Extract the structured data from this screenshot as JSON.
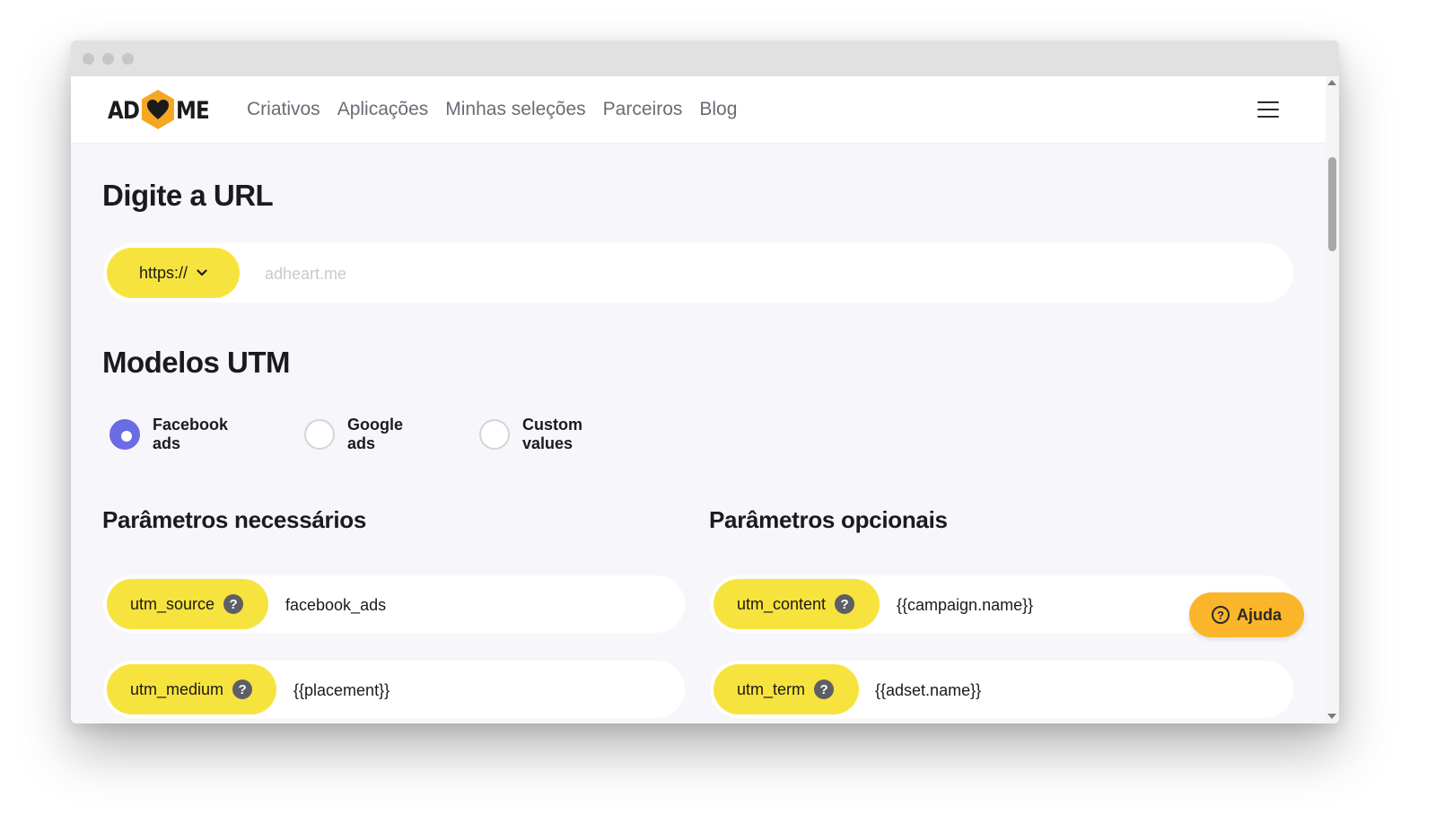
{
  "nav": {
    "logo_left": "AD",
    "logo_right": "ME",
    "links": [
      "Criativos",
      "Aplicações",
      "Minhas seleções",
      "Parceiros",
      "Blog"
    ]
  },
  "url_section": {
    "title": "Digite a URL",
    "protocol": "https://",
    "placeholder": "adheart.me",
    "value": ""
  },
  "utm_section": {
    "title": "Modelos UTM",
    "options": [
      {
        "label": "Facebook ads",
        "checked": true
      },
      {
        "label": "Google ads",
        "checked": false
      },
      {
        "label": "Custom values",
        "checked": false
      }
    ]
  },
  "required_params": {
    "title": "Parâmetros necessários",
    "items": [
      {
        "name": "utm_source",
        "help": "?",
        "value": "facebook_ads"
      },
      {
        "name": "utm_medium",
        "help": "?",
        "value": "{{placement}}"
      }
    ]
  },
  "optional_params": {
    "title": "Parâmetros opcionais",
    "items": [
      {
        "name": "utm_content",
        "help": "?",
        "value": "{{campaign.name}}"
      },
      {
        "name": "utm_term",
        "help": "?",
        "value": "{{adset.name}}"
      }
    ]
  },
  "help_button": {
    "icon": "?",
    "label": "Ajuda"
  },
  "colors": {
    "accent_yellow": "#f7e33d",
    "radio_selected": "#6a6ce3",
    "help_orange": "#fbb52a",
    "logo_orange": "#f5a623"
  }
}
